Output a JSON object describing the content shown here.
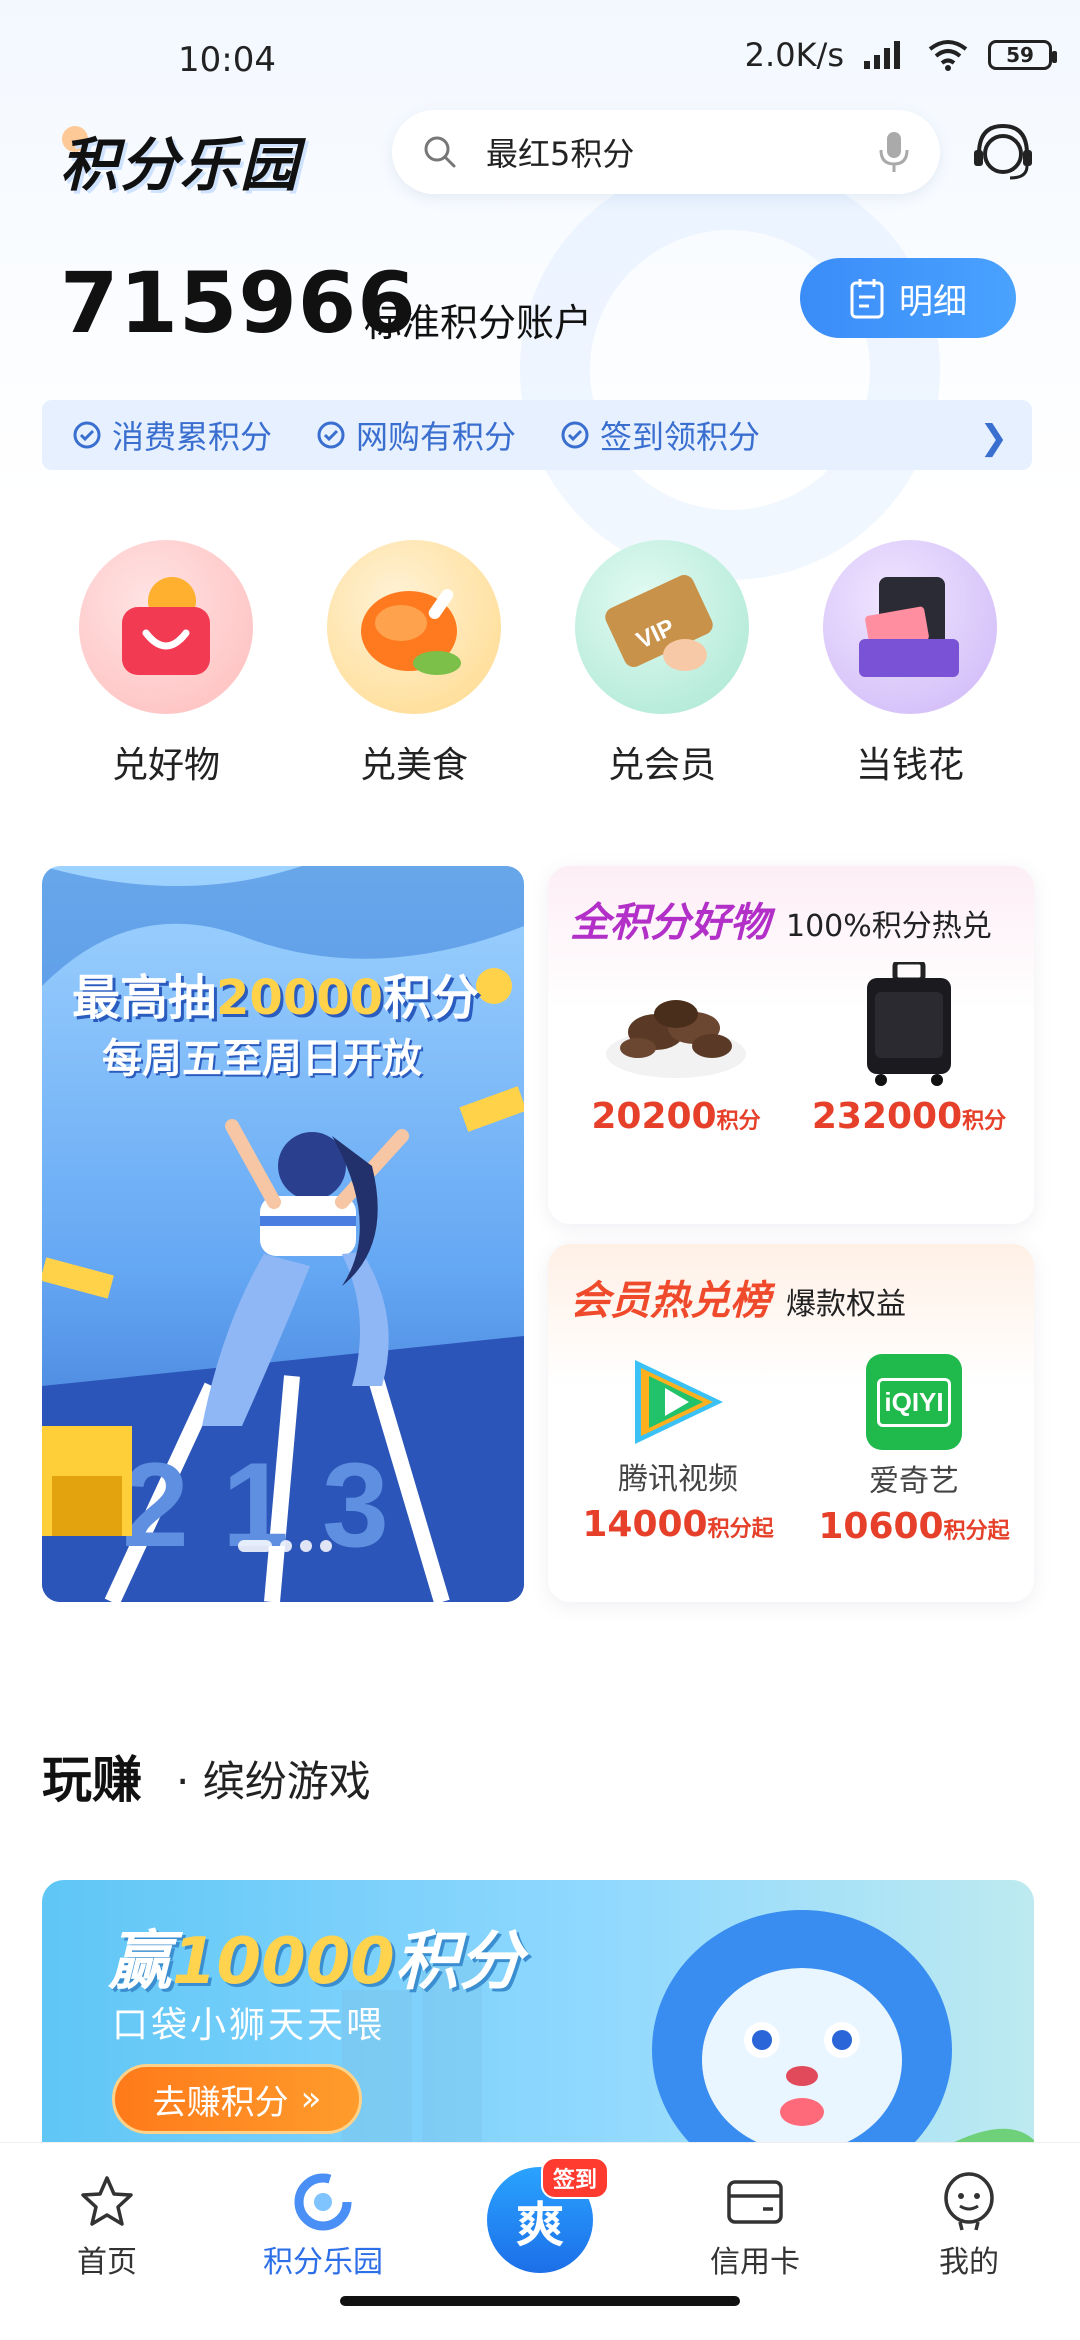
{
  "status_bar": {
    "time": "10:04",
    "net_speed": "2.0K/s",
    "battery": "59"
  },
  "header": {
    "logo": "积分乐园",
    "search_placeholder": "最红5积分"
  },
  "account": {
    "points": "715966",
    "points_label": "标准积分账户",
    "detail_button": "明细"
  },
  "tags": [
    {
      "label": "消费累积分"
    },
    {
      "label": "网购有积分"
    },
    {
      "label": "签到领积分"
    }
  ],
  "categories": [
    {
      "label": "兑好物",
      "icon": "shopping-bag-icon",
      "color": "#f25a6a"
    },
    {
      "label": "兑美食",
      "icon": "roast-chicken-icon",
      "color": "#ff8a2a"
    },
    {
      "label": "兑会员",
      "icon": "vip-card-icon",
      "color": "#d6a25a"
    },
    {
      "label": "当钱花",
      "icon": "wallet-cash-icon",
      "color": "#7a5ad6"
    }
  ],
  "banner": {
    "line1_prefix": "最高抽",
    "line1_highlight": "20000",
    "line1_suffix": "积分",
    "line2": "每周五至周日开放",
    "digits": "2 1 3"
  },
  "card_goods": {
    "title": "全积分好物",
    "subtitle": "100%积分热兑",
    "items": [
      {
        "price": "20200",
        "unit": "积分"
      },
      {
        "price": "232000",
        "unit": "积分"
      }
    ]
  },
  "card_member": {
    "title": "会员热兑榜",
    "subtitle": "爆款权益",
    "items": [
      {
        "name": "腾讯视频",
        "price": "14000",
        "unit": "积分起",
        "logo_text": ""
      },
      {
        "name": "爱奇艺",
        "price": "10600",
        "unit": "积分起",
        "logo_text": "iQIYI"
      }
    ]
  },
  "section": {
    "title": "玩赚",
    "subtitle": "· 缤纷游戏"
  },
  "game_banner": {
    "prefix": "赢",
    "highlight": "10000",
    "suffix": "积分",
    "line2": "口袋小狮天天喂",
    "button": "去赚积分"
  },
  "nav": [
    {
      "label": "首页",
      "icon": "star-icon",
      "active": false
    },
    {
      "label": "积分乐园",
      "icon": "points-park-icon",
      "active": true
    },
    {
      "label": "",
      "icon": "sign-in-icon",
      "badge": "签到",
      "active": false
    },
    {
      "label": "信用卡",
      "icon": "credit-card-icon",
      "active": false
    },
    {
      "label": "我的",
      "icon": "profile-icon",
      "active": false
    }
  ]
}
